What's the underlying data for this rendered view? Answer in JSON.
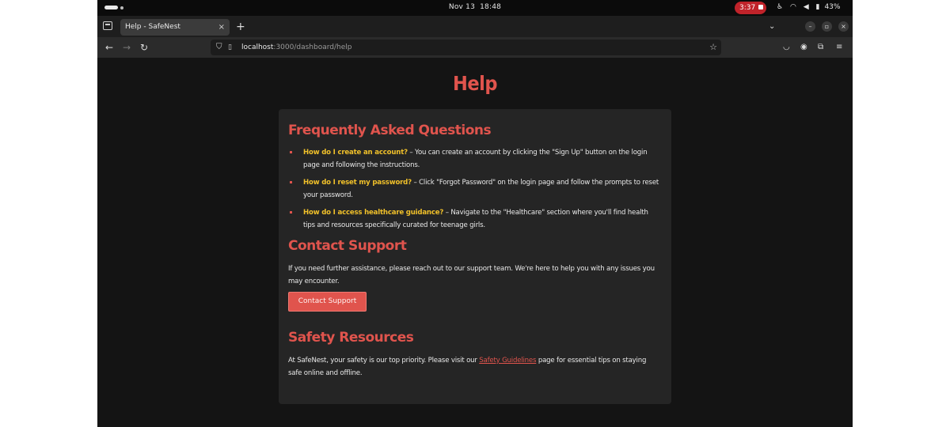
{
  "os": {
    "date": "Nov 13",
    "time": "18:48",
    "recording": "3:37",
    "battery": "43%"
  },
  "browser": {
    "tab_title": "Help - SafeNest",
    "tab_close": "×",
    "new_tab": "+",
    "url_host": "localhost",
    "url_path": ":3000/dashboard/help"
  },
  "page": {
    "title": "Help",
    "faq": {
      "heading": "Frequently Asked Questions",
      "items": [
        {
          "question": "How do I create an account?",
          "answer": " – You can create an account by clicking the \"Sign Up\" button on the login page and following the instructions."
        },
        {
          "question": "How do I reset my password?",
          "answer": " – Click \"Forgot Password\" on the login page and follow the prompts to reset your password."
        },
        {
          "question": "How do I access healthcare guidance?",
          "answer": " – Navigate to the \"Healthcare\" section where you'll find health tips and resources specifically curated for teenage girls."
        }
      ]
    },
    "contact": {
      "heading": "Contact Support",
      "text": "If you need further assistance, please reach out to our support team. We're here to help you with any issues you may encounter.",
      "button": "Contact Support"
    },
    "safety": {
      "heading": "Safety Resources",
      "text_before": "At SafeNest, your safety is our top priority. Please visit our ",
      "link": "Safety Guidelines",
      "text_after": " page for essential tips on staying safe online and offline."
    }
  },
  "colors": {
    "accent": "#e0544d",
    "question": "#f0c02a",
    "card": "#252525",
    "background": "#141414"
  }
}
